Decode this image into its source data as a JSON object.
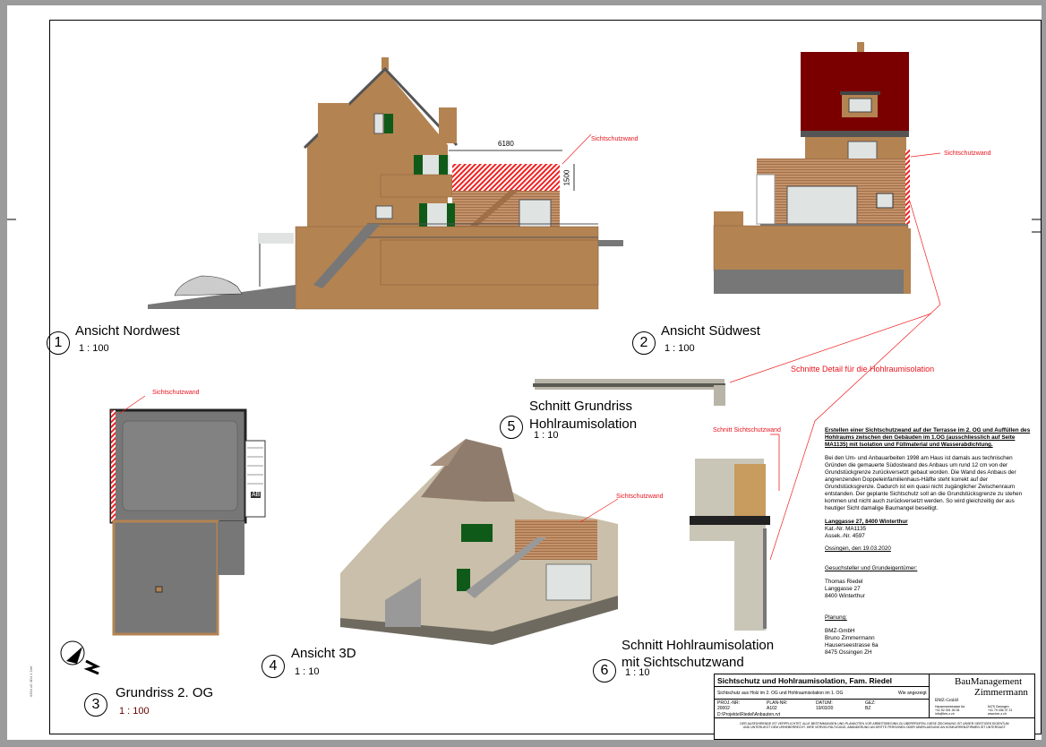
{
  "views": [
    {
      "num": "1",
      "title": "Ansicht Nordwest",
      "scale": "1 : 100"
    },
    {
      "num": "2",
      "title": "Ansicht Südwest",
      "scale": "1 : 100"
    },
    {
      "num": "3",
      "title": "Grundriss 2. OG",
      "scale": "1 : 100"
    },
    {
      "num": "4",
      "title": "Ansicht 3D",
      "scale": "1 : 10"
    },
    {
      "num": "5",
      "title_line1": "Schnitt Grundriss",
      "title_line2": "Hohlraumisolation",
      "scale": "1 : 10"
    },
    {
      "num": "6",
      "title_line1": "Schnitt Hohlraumisolation",
      "title_line2": "mit Sichtschutzwand",
      "scale": "1 : 10"
    }
  ],
  "annotations": {
    "sichtschutzwand": "Sichtschutzwand",
    "schnitt_sichtschutzwand": "Schnitt Sichtschutzwand",
    "schnitte_detail": "Schnitte Detail für die Hohlraumisolation",
    "dim_width": "6180",
    "dim_height": "1500",
    "plan_label": "AB"
  },
  "description": {
    "heading": "Erstellen einer Sichtschutzwand auf der Terrasse im 2. OG und Auffüllen des Hohlraums zwischen den Gebäuden im 1.OG (ausschliesslich auf Seite MA1135) mit Isolation und Füllmaterial und Wasserabdichtung.",
    "body": "Bei den Um- und Anbauarbeiten 1998 am Haus ist damals aus technischen Gründen die gemauerte Südostwand des Anbaus um rund 12 cm von der Grundstückgrenze zurückversetzt gebaut worden. Die Wand des Anbaus der angrenzenden Doppeleinfamilienhaus-Hälfte steht korrekt auf der Grundstücksgrenze. Dadurch ist ein quasi nicht zugänglicher Zwischenraum entstanden. Der geplante Sichtschutz soll an die Grundstücksgrenze zu stehen kommen und nicht auch zurückversetzt werden. So wird gleichzeitig der aus heutiger Sicht damalige Baumangel beseitigt.",
    "address": "Langgasse 27, 8400 Winterthur",
    "kat": "Kat.-Nr. MA1135",
    "assek": "Assek.-Nr. 4597",
    "date": "Ossingen, den 19.03.2020",
    "owner_label": "Gesuchsteller und Grundeigentümer:",
    "owner": [
      "Thomas Riedel",
      "Langgasse 27",
      "8400 Winterthur"
    ],
    "planning_label": "Planung:",
    "planner": [
      "BMZ-GmbH",
      "Bruno Zimmermann",
      "Hauserseestrasse 6a",
      "8475 Ossingen ZH"
    ]
  },
  "title_block": {
    "title": "Sichtschutz und Hohlraumisolation, Fam. Riedel",
    "subtitle": "Sichtschutz aus Holz im 2. OG und Hohlraumisolation im 1. OG",
    "scale": "Wie angezeigt",
    "fields": [
      {
        "label": "PROJ.-NR:",
        "value": "20002"
      },
      {
        "label": "PLAN-NR:",
        "value": "A102"
      },
      {
        "label": "DATUM:",
        "value": "19/03/20"
      },
      {
        "label": "GEZ:",
        "value": "BZ"
      }
    ],
    "path": "D:\\Projekte\\Riedel\\Anbauten.rvt",
    "disclaimer1": "DER AUSFÜHRENDE IST VERPFLICHTET, ALLE BESTIMMUNGEN UND PLANKOTEN VOR ARBEITSBEGINN ZU ÜBERPRÜFEN. DIESE ZEICHNUNG IST UNSER GEISTIGES EIGENTUM",
    "disclaimer2": "UND UNTERLIEGT DEM URHEBERRECHT. IHRE VERVIELFÄLTIGUNG, ABÄNDERUNG AN DRITTE PERSONEN ODER ÜBERLASSUNG AN KONKURRENZFIRMEN IST UNTERSAGT.",
    "company1": "BauManagement",
    "company2": "Zimmermann",
    "company_small": "BMZ-GmbH",
    "contact_left": [
      "Hauserseestrasse 6a",
      "+41 52 301 26 06",
      "info@bm-z.ch"
    ],
    "contact_right": [
      "8475 Ossingen",
      "+41 79 436 37 21",
      "www.bm-z.ch"
    ]
  },
  "margin_text": "0394 o5 4D4 1 2ref",
  "colors": {
    "wall": "#b38352",
    "roof_red": "#7a0000",
    "shutter": "#0f5a18",
    "annot": "#e8141e",
    "concrete": "#7a7a7a"
  }
}
